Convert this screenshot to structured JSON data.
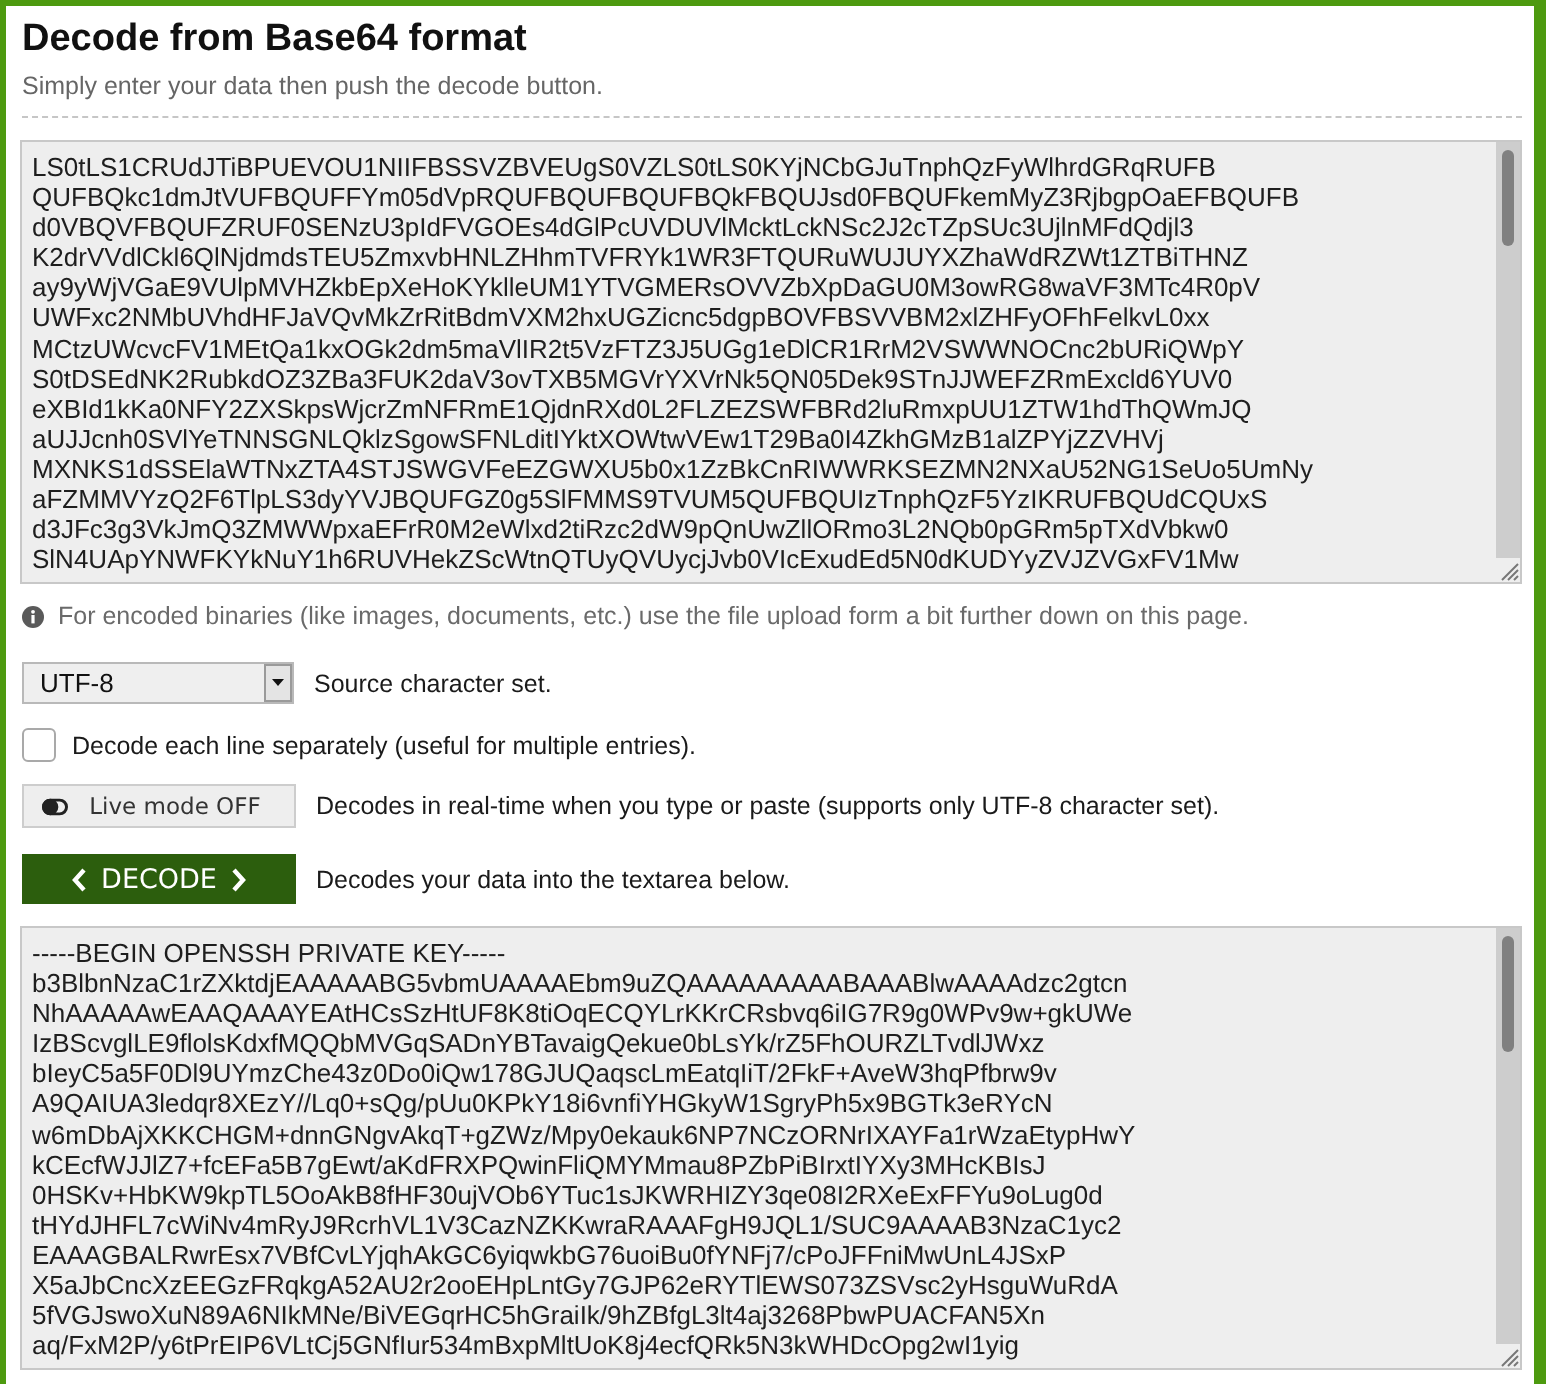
{
  "header": {
    "title": "Decode from Base64 format",
    "subtitle": "Simply enter your data then push the decode button."
  },
  "encoded_input": {
    "lines": [
      "LS0tLS1CRUdJTiBPUEVOU1NIIFBSSVZBVEUgS0VZLS0tLS0KYjNCbGJuTnphQzFyWlhrdGRqRUFB",
      "QUFBQkc1dmJtVUFBQUFFYm05dVpRQUFBQUFBQUFBQkFBQUJsd0FBQUFkemMyZ3RjbgpOaEFBQUFB",
      "d0VBQVFBQUFZRUF0SENzU3pIdFVGOEs4dGlPcUVDUVlMcktLckNSc2J2cTZpSUc3UjlnMFdQdjl3",
      "K2drVVdlCkl6QlNjdmdsTEU5ZmxvbHNLZHhmTVFRYk1WR3FTQURuWUJUYXZhaWdRZWt1ZTBiTHNZ",
      "ay9yWjVGaE9VUlpMVHZkbEpXeHoKYklleUM1YTVGMERsOVVZbXpDaGU0M3owRG8waVF3MTc4R0pV",
      "UWFxc2NMbUVhdHFJaVQvMkZrRitBdmVXM2hxUGZicnc5dgpBOVFBSVVBM2xlZHFyOFhFelkvL0xx",
      "MCtzUWcvcFV1MEtQa1kxOGk2dm5maVlIR2t5VzFTZ3J5UGg1eDlCR1RrM2VSWWNOCnc2bURiQWpY",
      "S0tDSEdNK2RubkdOZ3ZBa3FUK2daV3ovTXB5MGVrYXVrNk5QN05Dek9STnJJWEFZRmExcld6YUV0",
      "eXBId1kKa0NFY2ZXSkpsWjcrZmNFRmE1QjdnRXd0L2FLZEZSWFBRd2luRmxpUU1ZTW1hdThQWmJQ",
      "aUJJcnh0SVlYeTNNSGNLQklzSgowSFNLditIYktXOWtwVEw1T29Ba0I4ZkhGMzB1alZPYjZZVHVj",
      "MXNKS1dSSElaWTNxZTA4STJSWGVFeEZGWXU5b0x1ZzBkCnRIWWRKSEZMN2NXaU52NG1SeUo5UmNy",
      "aFZMMVYzQ2F6TlpLS3dyYVJBQUFGZ0g5SlFMMS9TVUM5QUFBQUIzTnphQzF5YzIKRUFBQUdCQUxS",
      "d3JFc3g3VkJmQ3ZMWWpxaEFrR0M2eWlxd2tiRzc2dW9pQnUwZllORmo3L2NQb0pGRm5pTXdVbkw0",
      "SlN4UApYNWFKYkNuY1h6RUVHekZScWtnQTUyQVUycjJvb0VIcExudEd5N0dKUDYyZVJZVGxFV1Mw"
    ]
  },
  "info_note": "For encoded binaries (like images, documents, etc.) use the file upload form a bit further down on this page.",
  "options": [
    {
      "kind": "select",
      "value": "UTF-8",
      "description": "Source character set."
    },
    {
      "kind": "checkbox",
      "checked": false,
      "label": "Decode each line separately (useful for multiple entries)."
    },
    {
      "kind": "toggle",
      "on": false,
      "button_label": "Live mode OFF",
      "description": "Decodes in real-time when you type or paste (supports only UTF-8 character set)."
    },
    {
      "kind": "action",
      "button_label": "DECODE",
      "description": "Decodes your data into the textarea below."
    }
  ],
  "decoded_output": {
    "lines": [
      "-----BEGIN OPENSSH PRIVATE KEY-----",
      "b3BlbnNzaC1rZXktdjEAAAAABG5vbmUAAAAEbm9uZQAAAAAAAAABAAABlwAAAAdzc2gtcn",
      "NhAAAAAwEAAQAAAYEAtHCsSzHtUF8K8tiOqECQYLrKKrCRsbvq6iIG7R9g0WPv9w+gkUWe",
      "IzBScvglLE9flolsKdxfMQQbMVGqSADnYBTavaigQekue0bLsYk/rZ5FhOURZLTvdlJWxz",
      "bIeyC5a5F0Dl9UYmzChe43z0Do0iQw178GJUQaqscLmEatqIiT/2FkF+AveW3hqPfbrw9v",
      "A9QAIUA3ledqr8XEzY//Lq0+sQg/pUu0KPkY18i6vnfiYHGkyW1SgryPh5x9BGTk3eRYcN",
      "w6mDbAjXKKCHGM+dnnGNgvAkqT+gZWz/Mpy0ekauk6NP7NCzORNrIXAYFa1rWzaEtypHwY",
      "kCEcfWJJlZ7+fcEFa5B7gEwt/aKdFRXPQwinFliQMYMmau8PZbPiBIrxtIYXy3MHcKBIsJ",
      "0HSKv+HbKW9kpTL5OoAkB8fHF30ujVOb6YTuc1sJKWRHIZY3qe08I2RXeExFFYu9oLug0d",
      "tHYdJHFL7cWiNv4mRyJ9RcrhVL1V3CazNZKKwraRAAAFgH9JQL1/SUC9AAAAB3NzaC1yc2",
      "EAAAGBALRwrEsx7VBfCvLYjqhAkGC6yiqwkbG76uoiBu0fYNFj7/cPoJFFniMwUnL4JSxP",
      "X5aJbCncXzEEGzFRqkgA52AU2r2ooEHpLntGy7GJP62eRYTlEWS073ZSVsc2yHsguWuRdA",
      "5fVGJswoXuN89A6NIkMNe/BiVEGqrHC5hGraiIk/9hZBfgL3lt4aj3268PbwPUACFAN5Xn",
      "aq/FxM2P/y6tPrEIP6VLtCj5GNfIur534mBxpMltUoK8j4ecfQRk5N3kWHDcOpg2wI1yig"
    ]
  }
}
